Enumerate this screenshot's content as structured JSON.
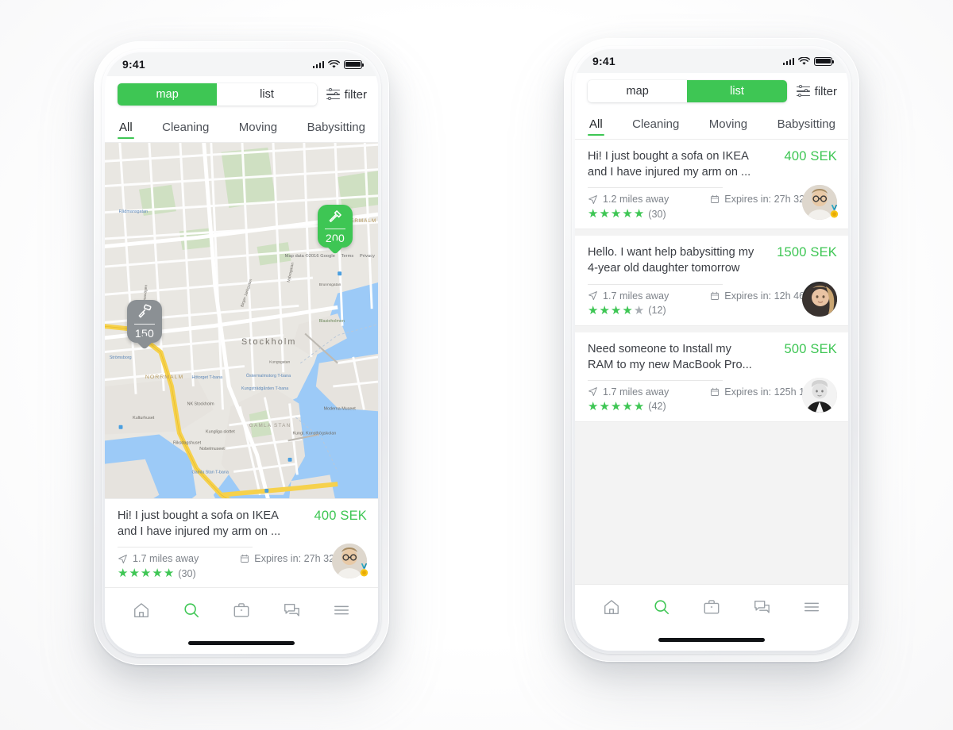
{
  "brand": {
    "green": "#3ec654",
    "gray": "#8b9094",
    "text": "#3a3d43",
    "muted": "#7e838a"
  },
  "status_bar": {
    "time": "9:41",
    "signal_icon": "cellular-bars-icon",
    "wifi_icon": "wifi-icon",
    "battery_icon": "battery-icon"
  },
  "toggle": {
    "map_label": "map",
    "list_label": "list"
  },
  "filter": {
    "label": "filter",
    "icon": "filter-sliders-icon"
  },
  "categories": [
    {
      "label": "All",
      "active": true
    },
    {
      "label": "Cleaning",
      "active": false
    },
    {
      "label": "Moving",
      "active": false
    },
    {
      "label": "Babysitting",
      "active": false
    }
  ],
  "map": {
    "attribution": "Map data ©2016 Google",
    "terms_label": "Terms",
    "privacy_label": "Privacy",
    "city_label": "Stockholm",
    "district_labels": [
      "NORRMALM",
      "ÖSTERMALM",
      "GAMLA STAN",
      "Strömsborg",
      "Blasieholmen"
    ],
    "poi_labels": [
      "Rådmansgatan",
      "Hötorget T-bana",
      "Östermalmstorg T-bana",
      "Kungsträdgården T-bana",
      "Gamla Stan T-bana",
      "NK Stockholm",
      "Kulturhuset",
      "Riksdagshuset",
      "Kungliga slottet",
      "Nobelmuseet",
      "Moderna Museet",
      "Kungl. Konsthögskolan"
    ],
    "pins": [
      {
        "amount": "200",
        "icon": "hammer-icon",
        "state": "active",
        "color": "#3ec654"
      },
      {
        "amount": "150",
        "icon": "paint-roller-icon",
        "state": "inactive",
        "color": "#8b9094"
      }
    ]
  },
  "map_card": {
    "title": "Hi! I just bought a sofa on IKEA and I have injured my arm on ...",
    "price": "400 SEK",
    "distance": "1.7 miles away",
    "expires": "Expires in: 27h 32m",
    "rating": 5,
    "reviews": "(30)",
    "avatar": "avatar-man-glasses",
    "badge": "medal-badge-icon"
  },
  "list_items": [
    {
      "title": "Hi! I just bought a sofa on IKEA and I have injured my arm on ...",
      "price": "400 SEK",
      "distance": "1.2 miles away",
      "expires": "Expires in: 27h 32m",
      "rating": 5,
      "reviews": "(30)",
      "avatar": "avatar-man-glasses",
      "badge": "medal-badge-icon"
    },
    {
      "title": "Hello. I want help babysitting my 4-year old daughter tomorrow",
      "price": "1500 SEK",
      "distance": "1.7 miles away",
      "expires": "Expires in: 12h 46m",
      "rating": 4,
      "reviews": "(12)",
      "avatar": "avatar-woman-blonde",
      "badge": null
    },
    {
      "title": "Need someone  to Install my RAM to my new MacBook Pro...",
      "price": "500 SEK",
      "distance": "1.7 miles away",
      "expires": "Expires in: 125h 12m",
      "rating": 5,
      "reviews": "(42)",
      "avatar": "avatar-woman-bw",
      "badge": null
    }
  ],
  "bottom_nav": [
    {
      "icon": "home-icon",
      "active": false
    },
    {
      "icon": "search-icon",
      "active": true
    },
    {
      "icon": "briefcase-icon",
      "active": false
    },
    {
      "icon": "chat-icon",
      "active": false
    },
    {
      "icon": "menu-icon",
      "active": false
    }
  ],
  "meta_icons": {
    "distance": "navigation-arrow-icon",
    "expires": "calendar-icon",
    "star": "star-icon"
  }
}
